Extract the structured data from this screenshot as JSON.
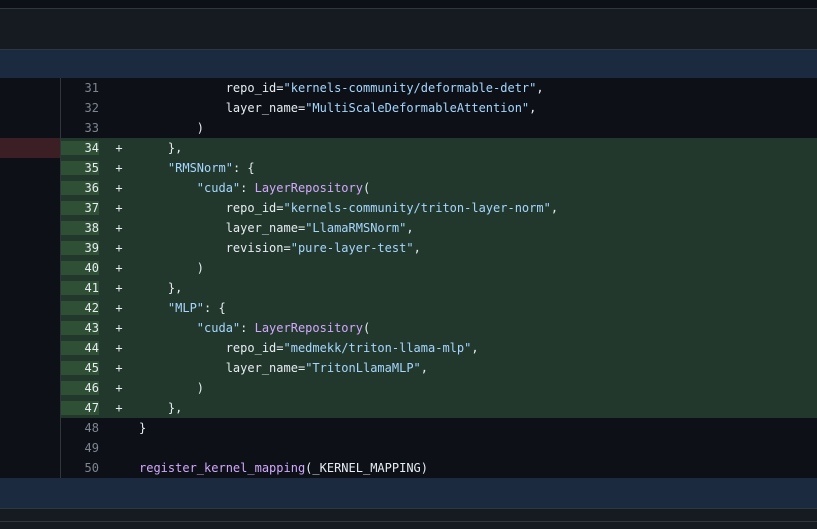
{
  "diff": {
    "lines": [
      {
        "num": "31",
        "sign": "",
        "added": false,
        "indent": "            ",
        "tokens": [
          {
            "t": "repo_id=",
            "c": "plain"
          },
          {
            "t": "\"kernels-community/deformable-detr\"",
            "c": "str"
          },
          {
            "t": ",",
            "c": "plain"
          }
        ]
      },
      {
        "num": "32",
        "sign": "",
        "added": false,
        "indent": "            ",
        "tokens": [
          {
            "t": "layer_name=",
            "c": "plain"
          },
          {
            "t": "\"MultiScaleDeformableAttention\"",
            "c": "str"
          },
          {
            "t": ",",
            "c": "plain"
          }
        ]
      },
      {
        "num": "33",
        "sign": "",
        "added": false,
        "indent": "        ",
        "tokens": [
          {
            "t": ")",
            "c": "plain"
          }
        ]
      },
      {
        "num": "34",
        "sign": "+",
        "added": true,
        "indent": "    ",
        "tokens": [
          {
            "t": "},",
            "c": "plain"
          }
        ]
      },
      {
        "num": "35",
        "sign": "+",
        "added": true,
        "indent": "    ",
        "tokens": [
          {
            "t": "\"RMSNorm\"",
            "c": "str"
          },
          {
            "t": ": {",
            "c": "plain"
          }
        ]
      },
      {
        "num": "36",
        "sign": "+",
        "added": true,
        "indent": "        ",
        "tokens": [
          {
            "t": "\"cuda\"",
            "c": "str"
          },
          {
            "t": ": ",
            "c": "plain"
          },
          {
            "t": "LayerRepository",
            "c": "fn"
          },
          {
            "t": "(",
            "c": "plain"
          }
        ]
      },
      {
        "num": "37",
        "sign": "+",
        "added": true,
        "indent": "            ",
        "tokens": [
          {
            "t": "repo_id=",
            "c": "plain"
          },
          {
            "t": "\"kernels-community/triton-layer-norm\"",
            "c": "str"
          },
          {
            "t": ",",
            "c": "plain"
          }
        ]
      },
      {
        "num": "38",
        "sign": "+",
        "added": true,
        "indent": "            ",
        "tokens": [
          {
            "t": "layer_name=",
            "c": "plain"
          },
          {
            "t": "\"LlamaRMSNorm\"",
            "c": "str"
          },
          {
            "t": ",",
            "c": "plain"
          }
        ]
      },
      {
        "num": "39",
        "sign": "+",
        "added": true,
        "indent": "            ",
        "tokens": [
          {
            "t": "revision=",
            "c": "plain"
          },
          {
            "t": "\"pure-layer-test\"",
            "c": "str"
          },
          {
            "t": ",",
            "c": "plain"
          }
        ]
      },
      {
        "num": "40",
        "sign": "+",
        "added": true,
        "indent": "        ",
        "tokens": [
          {
            "t": ")",
            "c": "plain"
          }
        ]
      },
      {
        "num": "41",
        "sign": "+",
        "added": true,
        "indent": "    ",
        "tokens": [
          {
            "t": "},",
            "c": "plain"
          }
        ]
      },
      {
        "num": "42",
        "sign": "+",
        "added": true,
        "indent": "    ",
        "tokens": [
          {
            "t": "\"MLP\"",
            "c": "str"
          },
          {
            "t": ": {",
            "c": "plain"
          }
        ]
      },
      {
        "num": "43",
        "sign": "+",
        "added": true,
        "indent": "        ",
        "tokens": [
          {
            "t": "\"cuda\"",
            "c": "str"
          },
          {
            "t": ": ",
            "c": "plain"
          },
          {
            "t": "LayerRepository",
            "c": "fn"
          },
          {
            "t": "(",
            "c": "plain"
          }
        ]
      },
      {
        "num": "44",
        "sign": "+",
        "added": true,
        "indent": "            ",
        "tokens": [
          {
            "t": "repo_id=",
            "c": "plain"
          },
          {
            "t": "\"medmekk/triton-llama-mlp\"",
            "c": "str"
          },
          {
            "t": ",",
            "c": "plain"
          }
        ]
      },
      {
        "num": "45",
        "sign": "+",
        "added": true,
        "indent": "            ",
        "tokens": [
          {
            "t": "layer_name=",
            "c": "plain"
          },
          {
            "t": "\"TritonLlamaMLP\"",
            "c": "str"
          },
          {
            "t": ",",
            "c": "plain"
          }
        ]
      },
      {
        "num": "46",
        "sign": "+",
        "added": true,
        "indent": "        ",
        "tokens": [
          {
            "t": ")",
            "c": "plain"
          }
        ]
      },
      {
        "num": "47",
        "sign": "+",
        "added": true,
        "indent": "    ",
        "tokens": [
          {
            "t": "},",
            "c": "plain"
          }
        ]
      },
      {
        "num": "48",
        "sign": "",
        "added": false,
        "indent": "",
        "tokens": [
          {
            "t": "}",
            "c": "plain"
          }
        ]
      },
      {
        "num": "49",
        "sign": "",
        "added": false,
        "indent": "",
        "tokens": []
      },
      {
        "num": "50",
        "sign": "",
        "added": false,
        "indent": "",
        "tokens": [
          {
            "t": "register_kernel_mapping",
            "c": "fn"
          },
          {
            "t": "(_KERNEL_MAPPING)",
            "c": "plain"
          }
        ]
      }
    ]
  },
  "colors": {
    "added_background": "#23382c",
    "added_gutter": "#2f5034",
    "string": "#a5d6ff",
    "function": "#d2a8ff",
    "hunk_header": "#1c2a40"
  }
}
